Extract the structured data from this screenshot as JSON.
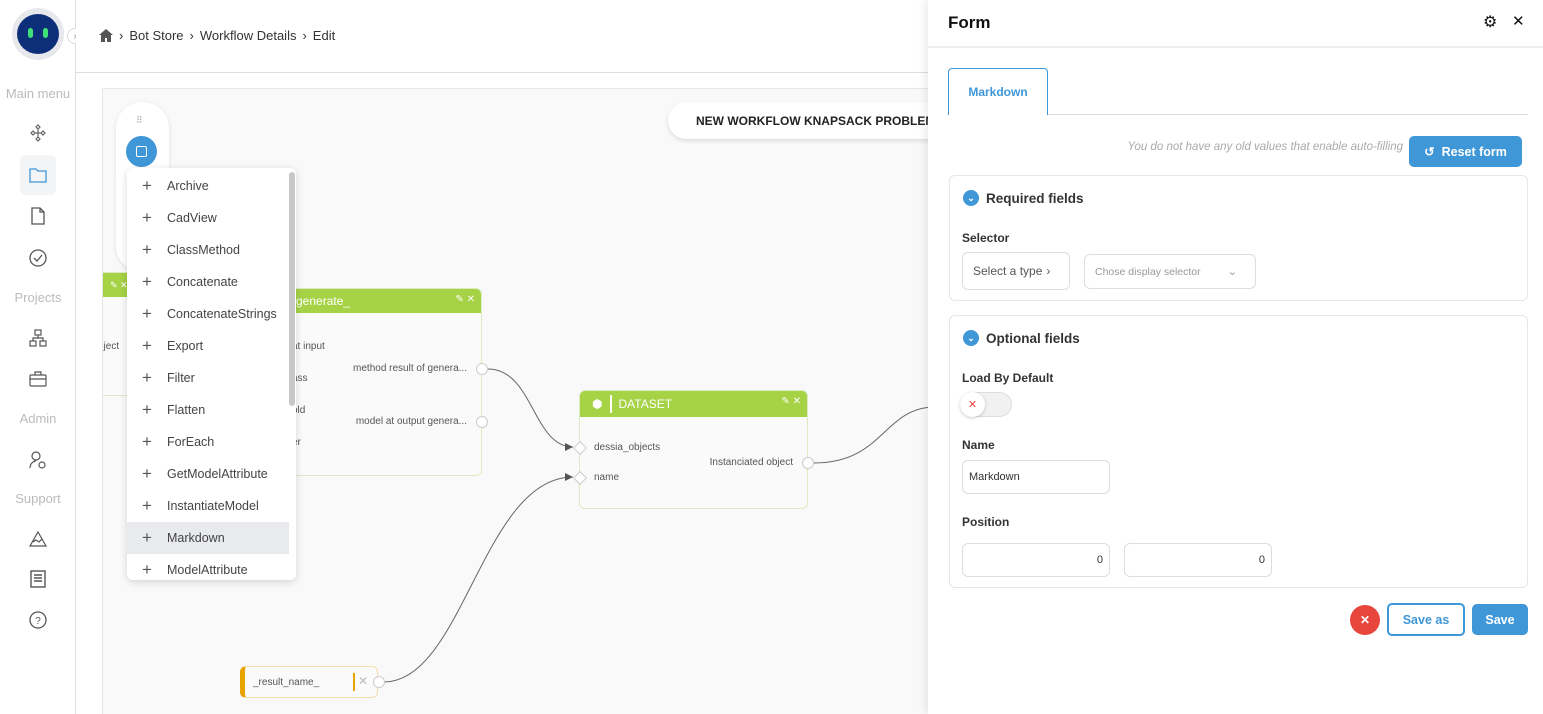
{
  "breadcrumb": {
    "items": [
      "Bot Store",
      "Workflow Details",
      "Edit"
    ]
  },
  "sidebar": {
    "sections": {
      "main": "Main menu",
      "projects": "Projects",
      "admin": "Admin",
      "support": "Support"
    }
  },
  "canvas": {
    "workflow_title": "NEW WORKFLOW KNAPSACK PROBLEM",
    "nodes": {
      "left_partial": {
        "input": "oject"
      },
      "generate": {
        "title": "generate_",
        "inputs": [
          "at input",
          "ass",
          "old",
          "er"
        ],
        "outputs": [
          "method result of genera...",
          "model at output genera..."
        ]
      },
      "dataset": {
        "title": "DATASET",
        "inputs": [
          "dessia_objects",
          "name"
        ],
        "output": "Instanciated object"
      },
      "result_name": {
        "title": "_result_name_"
      }
    }
  },
  "block_menu": {
    "items": [
      "Archive",
      "CadView",
      "ClassMethod",
      "Concatenate",
      "ConcatenateStrings",
      "Export",
      "Filter",
      "Flatten",
      "ForEach",
      "GetModelAttribute",
      "InstantiateModel",
      "Markdown",
      "ModelAttribute"
    ],
    "selected": "Markdown"
  },
  "form": {
    "title": "Form",
    "tab": "Markdown",
    "hint": "You do not have any old values that enable auto-filling",
    "reset_label": "Reset form",
    "required": {
      "title": "Required fields",
      "selector_label": "Selector",
      "type_select": "Select a type",
      "display_select_placeholder": "Chose display selector"
    },
    "optional": {
      "title": "Optional fields",
      "load_label": "Load By Default",
      "load_value": false,
      "name_label": "Name",
      "name_value": "Markdown",
      "position_label": "Position",
      "position_x": "0",
      "position_y": "0"
    },
    "save_as_label": "Save as",
    "save_label": "Save"
  },
  "colors": {
    "accent": "#3f97d8",
    "node_header": "#a6d246",
    "danger": "#e8453c",
    "result_node": "#e8a300"
  }
}
